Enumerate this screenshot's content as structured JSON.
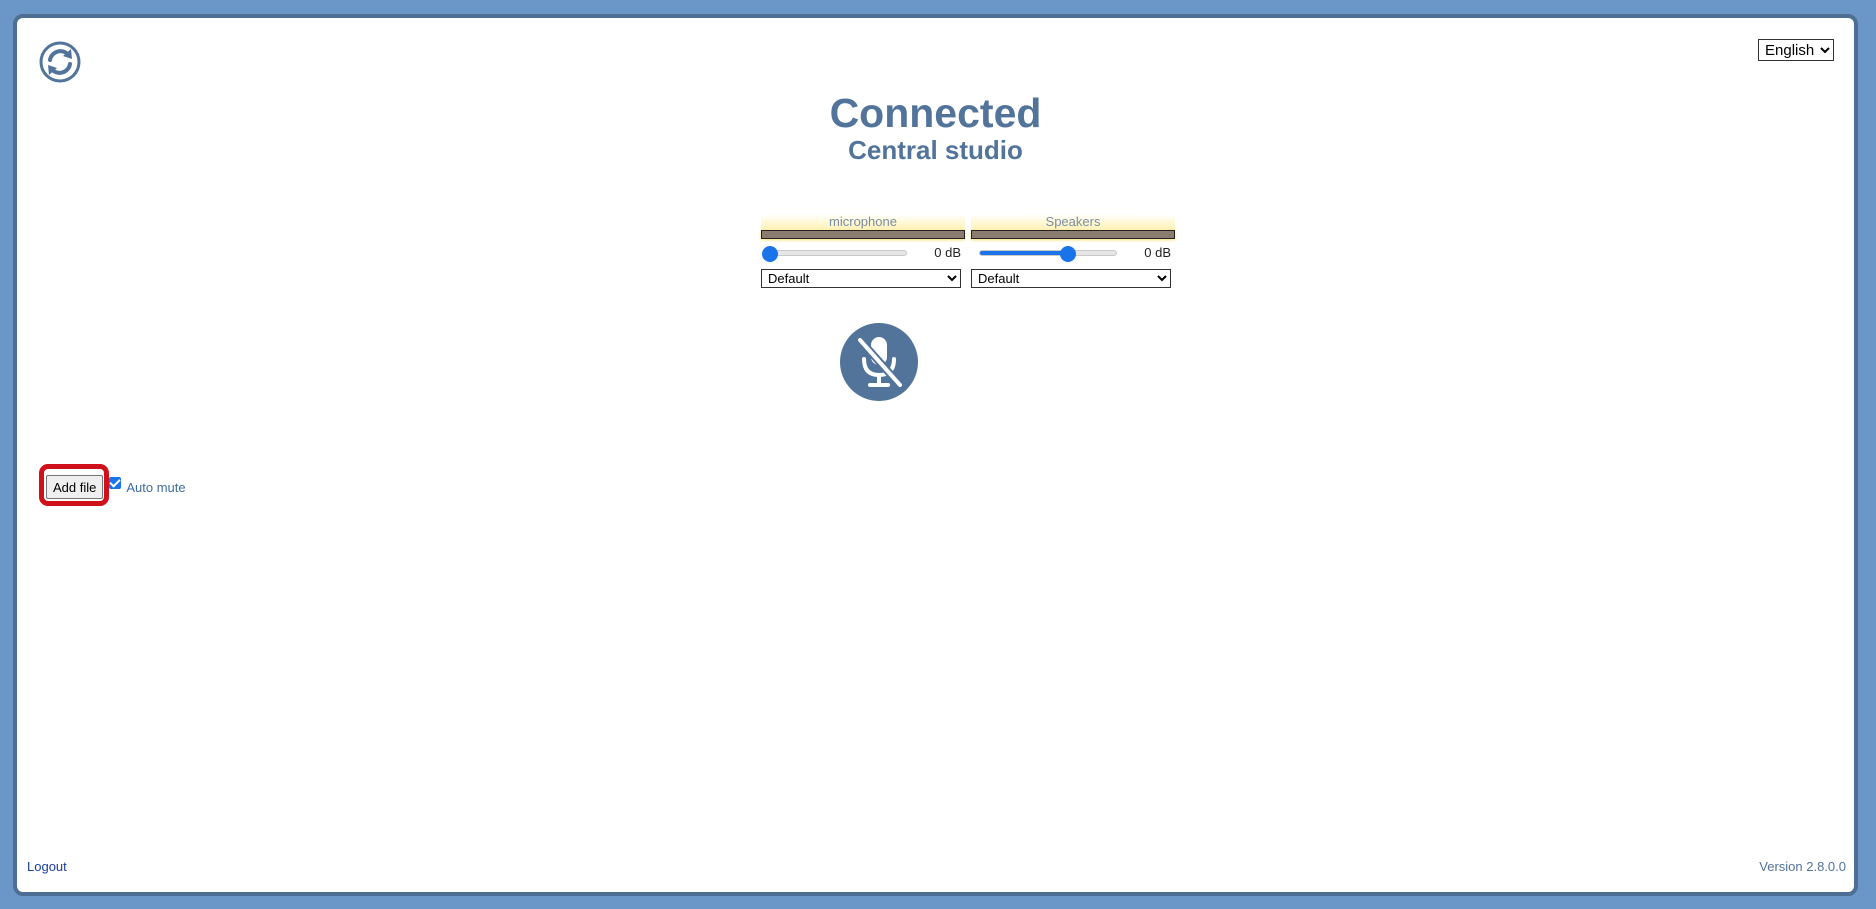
{
  "header": {
    "language": {
      "selected": "English",
      "options": [
        "English"
      ]
    },
    "reload_icon": "reload-icon"
  },
  "status": {
    "title": "Connected",
    "studio": "Central studio"
  },
  "audio": {
    "microphone": {
      "label": "microphone",
      "gain_text": "0 dB",
      "gain_level_fraction": 0.0,
      "device": "Default"
    },
    "speakers": {
      "label": "Speakers",
      "gain_text": "0 dB",
      "gain_level_fraction": 0.65,
      "device": "Default"
    },
    "mute_icon": "microphone-muted-icon"
  },
  "file": {
    "add_label": "Add file",
    "auto_mute_label": "Auto mute",
    "auto_mute_checked": true
  },
  "footer": {
    "logout_label": "Logout",
    "version": "Version 2.8.0.0"
  },
  "colors": {
    "background": "#6b96c8",
    "frame": "#4e6f94",
    "accent": "#52739a",
    "slider": "#1a73e8",
    "highlight": "#d0101a"
  }
}
